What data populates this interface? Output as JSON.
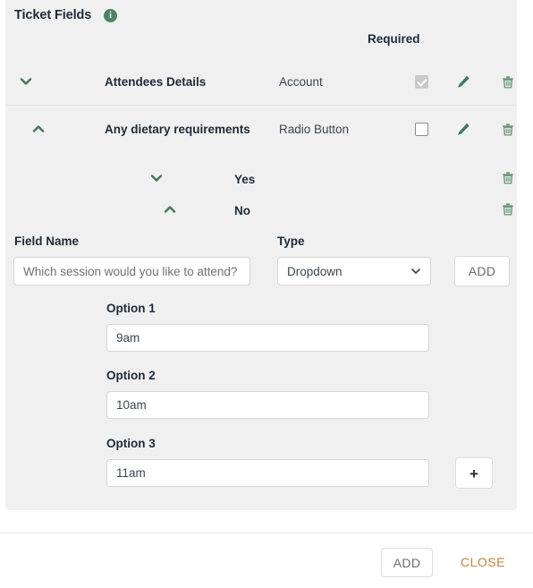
{
  "panel": {
    "title": "Ticket Fields",
    "info_icon_glyph": "i",
    "required_header": "Required",
    "accent_green": "#3d7a56",
    "close_orange": "#c8813a"
  },
  "fields": [
    {
      "chevron": "down",
      "label": "Attendees Details",
      "type": "Account",
      "required_checked": true,
      "required_disabled": true,
      "has_edit": true,
      "has_delete": true
    },
    {
      "chevron": "up",
      "label": "Any dietary requirements",
      "type": "Radio Button",
      "required_checked": false,
      "required_disabled": false,
      "has_edit": true,
      "has_delete": true
    }
  ],
  "sub_options": [
    {
      "chevron": "down",
      "label": "Yes"
    },
    {
      "chevron": "up",
      "label": "No"
    }
  ],
  "form": {
    "field_name_label": "Field Name",
    "field_name_value": "",
    "field_name_placeholder": "Which session would you like to attend?",
    "type_label": "Type",
    "type_value": "Dropdown",
    "type_options": [
      "Dropdown"
    ],
    "add_button_label": "ADD"
  },
  "options": [
    {
      "label": "Option 1",
      "value": "9am"
    },
    {
      "label": "Option 2",
      "value": "10am"
    },
    {
      "label": "Option 3",
      "value": "11am"
    }
  ],
  "add_option_button_label": "+",
  "footer": {
    "add_label": "ADD",
    "close_label": "CLOSE"
  }
}
